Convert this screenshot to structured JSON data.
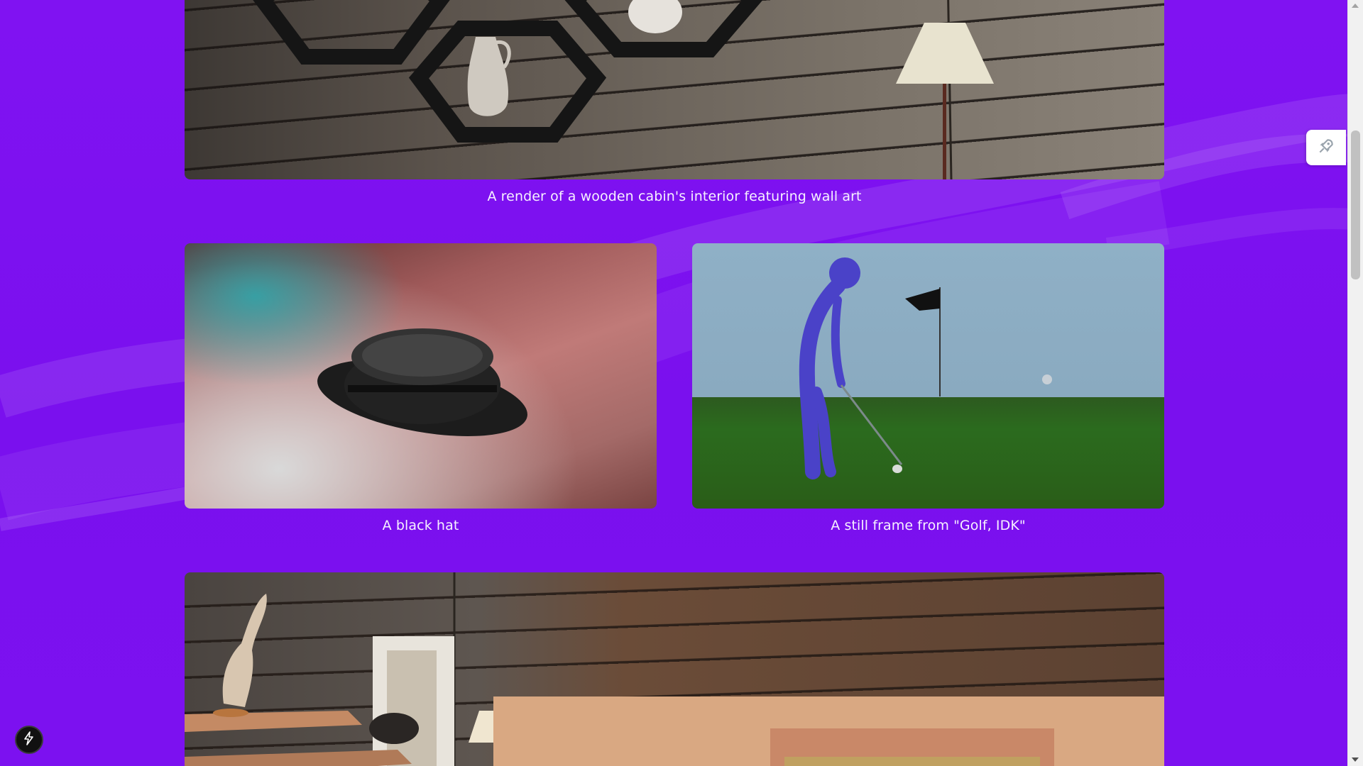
{
  "gallery": {
    "items": [
      {
        "caption": "A render of a wooden cabin's interior featuring wall art"
      },
      {
        "caption": "A black hat"
      },
      {
        "caption": "A still frame from \"Golf, IDK\""
      },
      {
        "caption": ""
      }
    ]
  },
  "side_widget": {
    "icon": "rocket-icon"
  },
  "badge": {
    "icon": "lightning-icon"
  },
  "colors": {
    "background": "#7c12f0",
    "caption_text": "#f6f0ff"
  }
}
